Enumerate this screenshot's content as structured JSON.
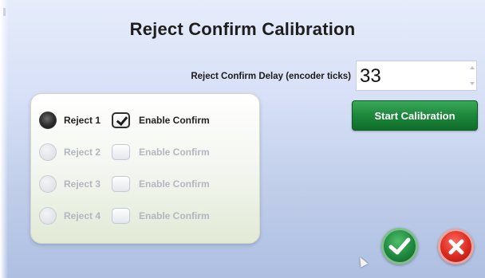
{
  "title": "Reject Confirm Calibration",
  "delay": {
    "label": "Reject Confirm Delay (encoder ticks)",
    "value": "33"
  },
  "start_button_label": "Start Calibration",
  "rejects": [
    {
      "label": "Reject 1",
      "selected": true,
      "confirm_label": "Enable Confirm",
      "confirm_checked": true
    },
    {
      "label": "Reject 2",
      "selected": false,
      "confirm_label": "Enable Confirm",
      "confirm_checked": false
    },
    {
      "label": "Reject 3",
      "selected": false,
      "confirm_label": "Enable Confirm",
      "confirm_checked": false
    },
    {
      "label": "Reject 4",
      "selected": false,
      "confirm_label": "Enable Confirm",
      "confirm_checked": false
    }
  ],
  "icons": {
    "ok": "checkmark-icon",
    "cancel": "close-icon"
  },
  "colors": {
    "start_button": "#1f8a3e",
    "ok": "#20893f",
    "cancel": "#dc2a20"
  }
}
